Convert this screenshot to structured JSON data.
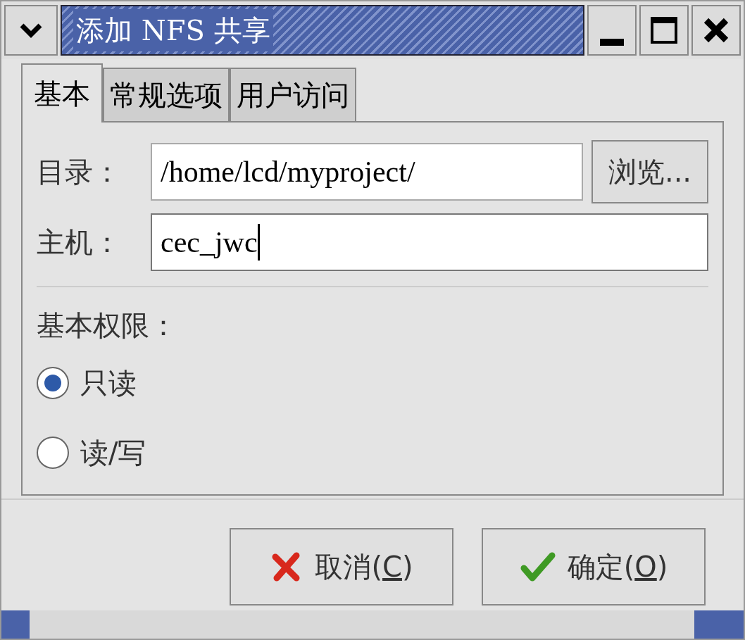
{
  "window": {
    "title": "添加 NFS 共享"
  },
  "tabs": [
    {
      "label": "基本",
      "selected": true
    },
    {
      "label": "常规选项",
      "selected": false
    },
    {
      "label": "用户访问",
      "selected": false
    }
  ],
  "fields": [
    {
      "label": "目录：",
      "value": "/home/lcd/myproject/",
      "focused": false,
      "button": "浏览..."
    },
    {
      "label": "主机：",
      "value": "cec_jwc",
      "focused": true
    }
  ],
  "permissions": {
    "label": "基本权限：",
    "options": [
      {
        "label": "只读",
        "selected": true
      },
      {
        "label": "读/写",
        "selected": false
      }
    ]
  },
  "buttons": [
    {
      "kind": "cancel",
      "prefix": "取消(",
      "mnemonic": "C",
      "suffix": ")"
    },
    {
      "kind": "ok",
      "prefix": "确定(",
      "mnemonic": "O",
      "suffix": ")"
    }
  ]
}
